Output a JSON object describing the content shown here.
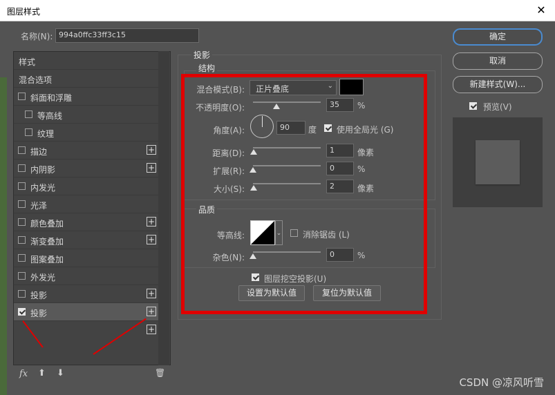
{
  "window": {
    "title": "图层样式",
    "close": "✕"
  },
  "name": {
    "label": "名称(N):",
    "value": "994a0ffc33ff3c15"
  },
  "left_list": [
    {
      "label": "样式",
      "checkbox": false,
      "checked": false,
      "plus": false,
      "selected": false,
      "indent": 0
    },
    {
      "label": "混合选项",
      "checkbox": false,
      "checked": false,
      "plus": false,
      "selected": false,
      "indent": 0
    },
    {
      "label": "斜面和浮雕",
      "checkbox": true,
      "checked": false,
      "plus": false,
      "selected": false,
      "indent": 0
    },
    {
      "label": "等高线",
      "checkbox": true,
      "checked": false,
      "plus": false,
      "selected": false,
      "indent": 1
    },
    {
      "label": "纹理",
      "checkbox": true,
      "checked": false,
      "plus": false,
      "selected": false,
      "indent": 1
    },
    {
      "label": "描边",
      "checkbox": true,
      "checked": false,
      "plus": true,
      "selected": false,
      "indent": 0
    },
    {
      "label": "内阴影",
      "checkbox": true,
      "checked": false,
      "plus": true,
      "selected": false,
      "indent": 0
    },
    {
      "label": "内发光",
      "checkbox": true,
      "checked": false,
      "plus": false,
      "selected": false,
      "indent": 0
    },
    {
      "label": "光泽",
      "checkbox": true,
      "checked": false,
      "plus": false,
      "selected": false,
      "indent": 0
    },
    {
      "label": "颜色叠加",
      "checkbox": true,
      "checked": false,
      "plus": true,
      "selected": false,
      "indent": 0
    },
    {
      "label": "渐变叠加",
      "checkbox": true,
      "checked": false,
      "plus": true,
      "selected": false,
      "indent": 0
    },
    {
      "label": "图案叠加",
      "checkbox": true,
      "checked": false,
      "plus": false,
      "selected": false,
      "indent": 0
    },
    {
      "label": "外发光",
      "checkbox": true,
      "checked": false,
      "plus": false,
      "selected": false,
      "indent": 0
    },
    {
      "label": "投影",
      "checkbox": true,
      "checked": false,
      "plus": true,
      "selected": false,
      "indent": 0
    },
    {
      "label": "投影",
      "checkbox": true,
      "checked": true,
      "plus": true,
      "selected": true,
      "indent": 0
    },
    {
      "label": "",
      "checkbox": false,
      "checked": false,
      "plus": true,
      "selected": false,
      "indent": 0
    }
  ],
  "bottom_icons": {
    "fx": "fx",
    "up": "⬆",
    "down": "⬇",
    "trash": "🗑"
  },
  "panel": {
    "section_title": "投影",
    "structure_title": "结构",
    "blend_mode": {
      "label": "混合模式(B):",
      "value": "正片叠底",
      "swatch_color": "#000000"
    },
    "opacity": {
      "label": "不透明度(O):",
      "value": "35",
      "unit": "%",
      "fraction": 0.35
    },
    "angle": {
      "label": "角度(A):",
      "value": "90",
      "unit": "度",
      "global_light": "使用全局光 (G)",
      "global_checked": true
    },
    "distance": {
      "label": "距离(D):",
      "value": "1",
      "unit": "像素",
      "fraction": 0.01
    },
    "spread": {
      "label": "扩展(R):",
      "value": "0",
      "unit": "%",
      "fraction": 0.0
    },
    "size": {
      "label": "大小(S):",
      "value": "2",
      "unit": "像素",
      "fraction": 0.01
    },
    "quality_title": "品质",
    "contour": {
      "label": "等高线:",
      "antialias": "消除锯齿 (L)",
      "antialias_checked": false
    },
    "noise": {
      "label": "杂色(N):",
      "value": "0",
      "unit": "%",
      "fraction": 0.0
    },
    "knockout": {
      "label": "图层挖空投影(U)",
      "checked": true
    },
    "make_default": "设置为默认值",
    "reset_default": "复位为默认值"
  },
  "buttons": {
    "ok": "确定",
    "cancel": "取消",
    "new_style": "新建样式(W)...",
    "preview": "预览(V)",
    "preview_checked": true
  },
  "watermark": "CSDN @凉风听雪",
  "colors": {
    "annotation_red": "#e00000",
    "accent_blue": "#4a8bd0"
  }
}
